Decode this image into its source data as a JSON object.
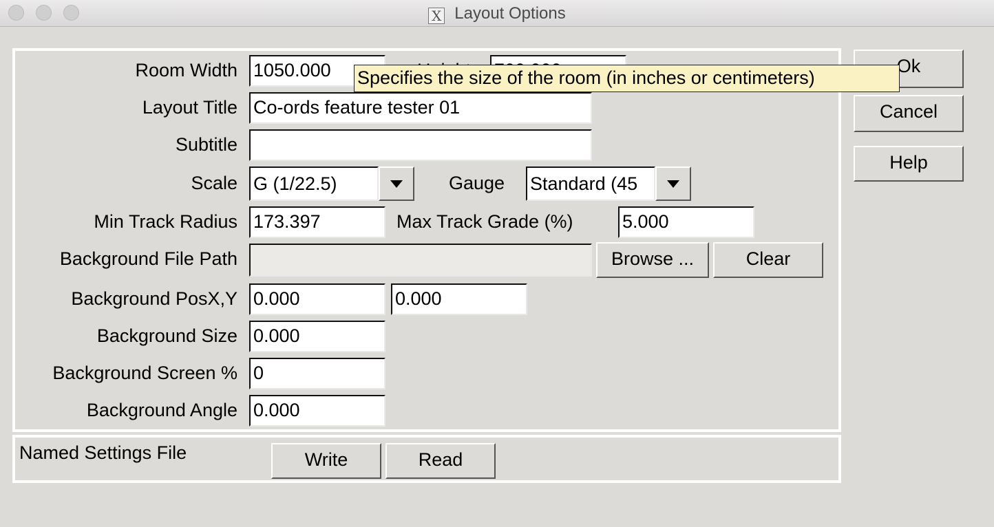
{
  "window": {
    "title": "Layout Options"
  },
  "form": {
    "room_width_label": "Room Width",
    "room_width_value": "1050.000",
    "height_label": "Height",
    "height_value": "700.000",
    "layout_title_label": "Layout Title",
    "layout_title_value": "Co-ords feature tester 01",
    "subtitle_label": "Subtitle",
    "subtitle_value": "",
    "scale_label": "Scale",
    "scale_value": "G (1/22.5)",
    "gauge_label": "Gauge",
    "gauge_value": "Standard (45",
    "min_radius_label": "Min Track Radius",
    "min_radius_value": "173.397",
    "max_grade_label": "Max Track Grade (%)",
    "max_grade_value": "5.000",
    "bg_file_label": "Background File Path",
    "bg_file_value": "",
    "browse_label": "Browse ...",
    "clear_label": "Clear",
    "bg_pos_label": "Background PosX,Y",
    "bg_pos_x": "0.000",
    "bg_pos_y": "0.000",
    "bg_size_label": "Background Size",
    "bg_size_value": "0.000",
    "bg_screen_label": "Background Screen %",
    "bg_screen_value": "0",
    "bg_angle_label": "Background Angle",
    "bg_angle_value": "0.000"
  },
  "settings": {
    "label": "Named Settings File",
    "write_label": "Write",
    "read_label": "Read"
  },
  "actions": {
    "ok_label": "Ok",
    "cancel_label": "Cancel",
    "help_label": "Help"
  },
  "tooltip": {
    "text": "Specifies the size of the room (in inches or centimeters)"
  }
}
